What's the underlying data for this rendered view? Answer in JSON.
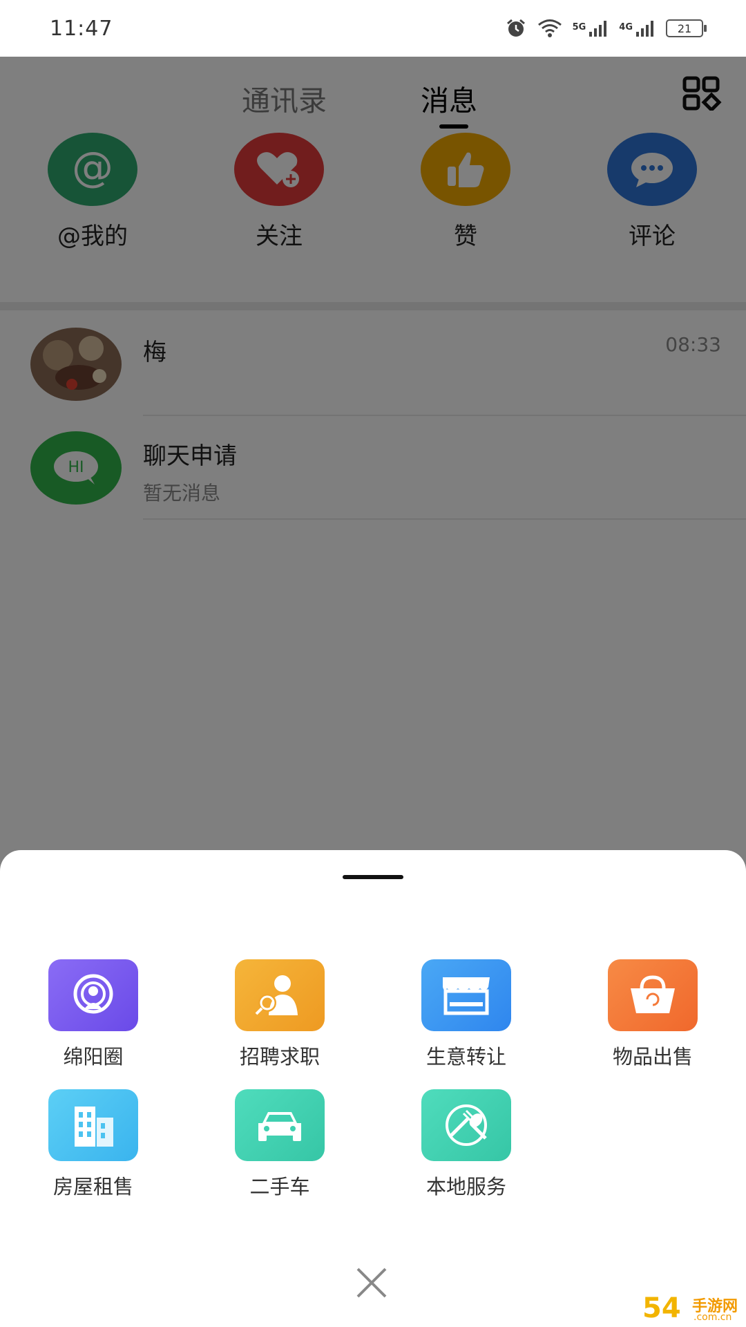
{
  "status_bar": {
    "time": "11:47",
    "net_5g": "5G",
    "net_4g": "4G",
    "battery": "21"
  },
  "tabs": {
    "contacts": "通讯录",
    "messages": "消息"
  },
  "quick_actions": [
    {
      "label": "@我的",
      "icon": "at-icon",
      "color": "#2ea86f"
    },
    {
      "label": "关注",
      "icon": "heart-plus-icon",
      "color": "#e23b3b"
    },
    {
      "label": "赞",
      "icon": "thumbs-up-icon",
      "color": "#f0a800"
    },
    {
      "label": "评论",
      "icon": "comment-bubble-icon",
      "color": "#2f74d6"
    }
  ],
  "chats": [
    {
      "name": "梅",
      "time": "08:33",
      "preview": ""
    },
    {
      "name": "聊天申请",
      "preview": "暂无消息",
      "avatar_text": "HI"
    }
  ],
  "sheet": {
    "services": [
      {
        "label": "绵阳圈",
        "icon": "broadcast-user-icon",
        "color": "#7a5cf0"
      },
      {
        "label": "招聘求职",
        "icon": "job-search-icon",
        "color": "#f0a52c"
      },
      {
        "label": "生意转让",
        "icon": "shop-icon",
        "color": "#3a96f0"
      },
      {
        "label": "物品出售",
        "icon": "basket-icon",
        "color": "#f57a3a"
      },
      {
        "label": "房屋租售",
        "icon": "building-icon",
        "color": "#4cc3f0"
      },
      {
        "label": "二手车",
        "icon": "car-icon",
        "color": "#3fd0b0"
      },
      {
        "label": "本地服务",
        "icon": "dining-icon",
        "color": "#3fd0b0"
      }
    ]
  },
  "watermark": {
    "main": "54",
    "sub": "手游网",
    "domain": ".com.cn"
  }
}
